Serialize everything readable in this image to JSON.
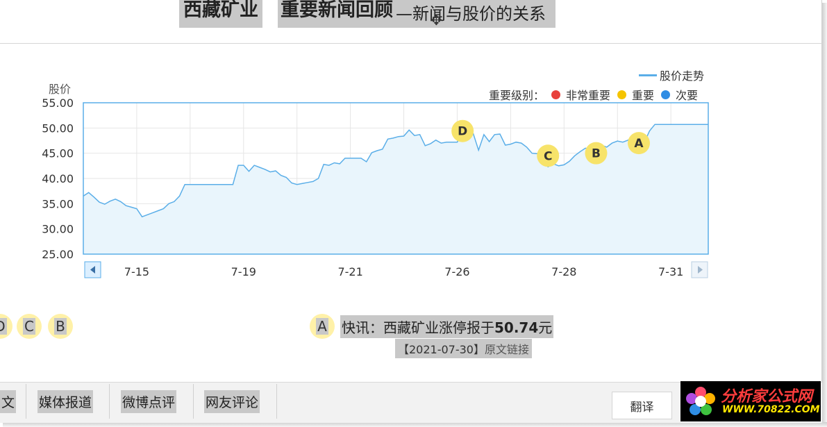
{
  "header": {
    "title_part1": "西藏矿业",
    "title_part2": "重要新闻回顾",
    "title_part3": "—新闻与股价的关系"
  },
  "legend": {
    "series_label": "股价走势",
    "importance_label": "重要级别：",
    "levels": [
      {
        "label": "非常重要",
        "color": "#e8413c"
      },
      {
        "label": "重要",
        "color": "#f5c400"
      },
      {
        "label": "次要",
        "color": "#2f8de4"
      }
    ]
  },
  "chart_data": {
    "type": "area",
    "ylabel": "股价",
    "ylim": [
      25,
      55
    ],
    "yticks": [
      "55.00",
      "50.00",
      "45.00",
      "40.00",
      "35.00",
      "30.00",
      "25.00"
    ],
    "xtick_labels": [
      "7-15",
      "7-19",
      "7-21",
      "7-26",
      "7-28",
      "7-31"
    ],
    "xtick_index": [
      10,
      30,
      50,
      70,
      90,
      110
    ],
    "grid": true,
    "line_color": "#5aaee8",
    "fill_color": "#e9f5fc",
    "series": [
      {
        "values": [
          36.5,
          37.2,
          36.3,
          35.3,
          34.9,
          35.5,
          35.9,
          35.4,
          34.6,
          34.3,
          34.0,
          32.4,
          32.8,
          33.2,
          33.6,
          34.0,
          35.0,
          35.4,
          36.5,
          38.8,
          38.8,
          38.8,
          38.8,
          38.8,
          38.8,
          38.8,
          38.8,
          38.8,
          38.8,
          42.6,
          42.6,
          41.4,
          42.6,
          42.2,
          41.8,
          41.3,
          41.5,
          40.6,
          40.2,
          39.1,
          38.8,
          39.0,
          39.2,
          39.4,
          40.0,
          42.8,
          42.6,
          43.1,
          42.9,
          44.0,
          44.0,
          44.0,
          44.0,
          43.3,
          45.1,
          45.5,
          45.8,
          47.8,
          48.0,
          48.3,
          48.4,
          49.6,
          48.5,
          48.7,
          46.5,
          46.9,
          47.6,
          47.0,
          47.2,
          47.2,
          47.2,
          49.2,
          49.6,
          48.9,
          45.6,
          48.7,
          47.3,
          48.7,
          48.8,
          46.6,
          46.8,
          47.2,
          47.0,
          46.2,
          45.0,
          44.9,
          43.7,
          42.3,
          42.9,
          42.5,
          42.7,
          43.4,
          44.5,
          45.3,
          46.0,
          45.8,
          46.2,
          46.6,
          46.2,
          47.0,
          47.4,
          47.2,
          47.6,
          48.3,
          47.0,
          47.1,
          49.4,
          50.7,
          50.7,
          50.7,
          50.7,
          50.7,
          50.7,
          50.7,
          50.7,
          50.7,
          50.7,
          50.7
        ]
      }
    ],
    "markers": [
      {
        "label": "D",
        "index": 71,
        "value": 49.4
      },
      {
        "label": "C",
        "index": 87,
        "value": 44.5
      },
      {
        "label": "B",
        "index": 96,
        "value": 45.0
      },
      {
        "label": "A",
        "index": 104,
        "value": 47.0
      }
    ]
  },
  "news_markers": [
    "D",
    "C",
    "B"
  ],
  "news": {
    "marker": "A",
    "headline_prefix": "快讯：西藏矿业涨停报于",
    "headline_value": "50.74",
    "headline_suffix": "元",
    "date": "【2021-07-30】",
    "link": "原文链接"
  },
  "tabs": [
    "文",
    "媒体报道",
    "微博点评",
    "网友评论"
  ],
  "translate_button": "翻译",
  "logo": {
    "line1": "分析家公式网",
    "line2": "WWW.70822.COM"
  }
}
